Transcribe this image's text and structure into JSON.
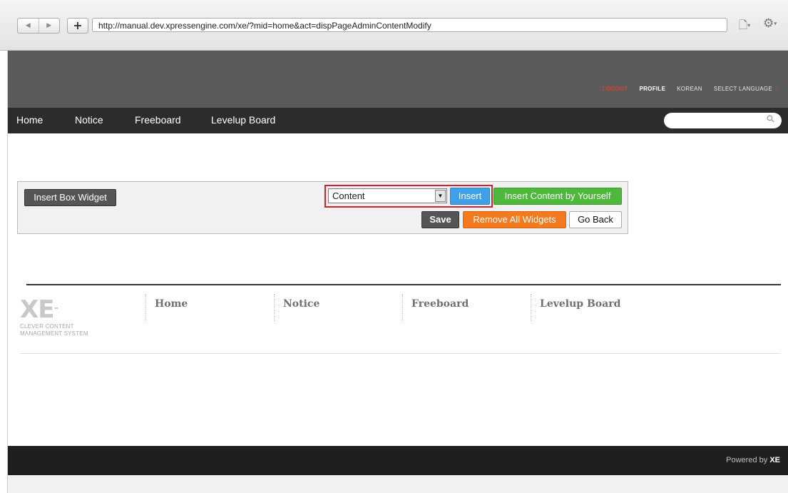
{
  "browser": {
    "url": "http://manual.dev.xpressengine.com/xe/?mid=home&act=dispPageAdminContentModify",
    "back_icon": "◀",
    "forward_icon": "▶",
    "add_icon": "+",
    "page_icon": "page-menu-icon",
    "tools_icon": "gear-menu-icon"
  },
  "utility": {
    "logout": "LOGOUT",
    "profile": "PROFILE",
    "korean": "KOREAN",
    "select_language": "SELECT LANGUAGE",
    "arrow": "⌄"
  },
  "gnb": {
    "items": [
      "Home",
      "Notice",
      "Freeboard",
      "Levelup Board"
    ]
  },
  "widget_toolbar": {
    "insert_box_widget": "Insert Box Widget",
    "select_value": "Content",
    "insert": "Insert",
    "insert_yourself": "Insert Content by Yourself",
    "save": "Save",
    "remove_all": "Remove All Widgets",
    "go_back": "Go Back"
  },
  "footer": {
    "logo": "XE",
    "logo_tm": "™",
    "tagline_1": "CLEVER CONTENT",
    "tagline_2": "MANAGEMENT SYSTEM",
    "nav": [
      "Home",
      "Notice",
      "Freeboard",
      "Levelup Board"
    ],
    "powered_by": "Powered by",
    "powered_brand": "XE"
  },
  "colors": {
    "header": "#5b5b5b",
    "gnb": "#2c2c2c",
    "insert": "#3ea1e8",
    "insert_yourself": "#4db83c",
    "remove": "#f47a20",
    "highlight": "#d0202b"
  }
}
